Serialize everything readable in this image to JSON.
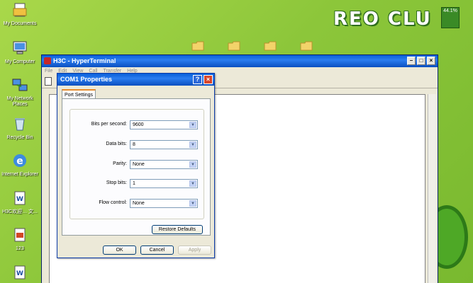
{
  "desktop": {
    "icons": [
      {
        "label": "My Documents"
      },
      {
        "label": "My Computer"
      },
      {
        "label": "My Network Places"
      },
      {
        "label": "Recycle Bin"
      },
      {
        "label": "Internet Explorer"
      },
      {
        "label": "H3C欢迎… 文..."
      },
      {
        "label": "123"
      }
    ],
    "brand_text": "REO CLU",
    "battery_text": "44.1%"
  },
  "hyperterminal": {
    "title": "H3C - HyperTerminal",
    "menu": [
      "File",
      "Edit",
      "View",
      "Call",
      "Transfer",
      "Help"
    ],
    "min_label": "–",
    "max_label": "□",
    "close_label": "×"
  },
  "dialog": {
    "title": "COM1 Properties",
    "help_label": "?",
    "close_label": "×",
    "tab_label": "Port Settings",
    "fields": [
      {
        "label": "Bits per second:",
        "value": "9600"
      },
      {
        "label": "Data bits:",
        "value": "8"
      },
      {
        "label": "Parity:",
        "value": "None"
      },
      {
        "label": "Stop bits:",
        "value": "1"
      },
      {
        "label": "Flow control:",
        "value": "None"
      }
    ],
    "restore_defaults_label": "Restore Defaults",
    "ok_label": "OK",
    "cancel_label": "Cancel",
    "apply_label": "Apply"
  }
}
